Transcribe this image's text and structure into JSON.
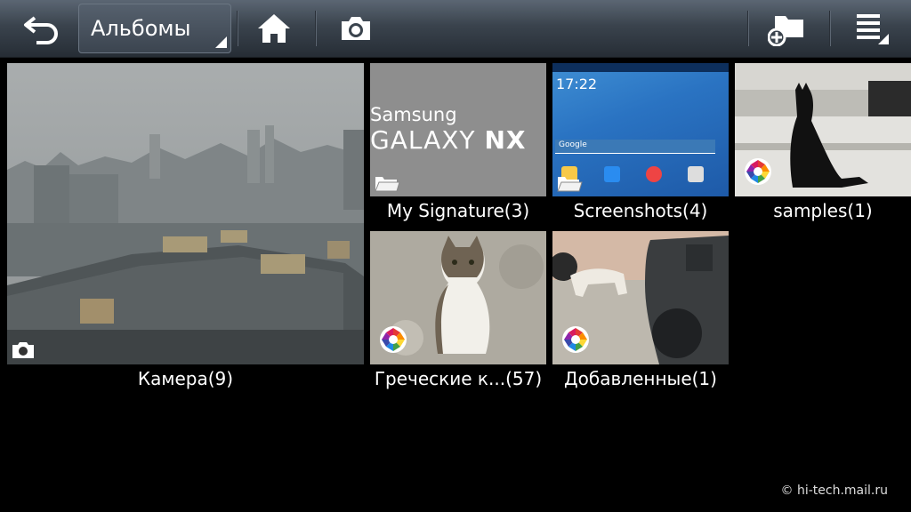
{
  "action_bar": {
    "album_selector_label": "Альбомы",
    "icons": [
      "back-icon",
      "home-icon",
      "camera-icon",
      "new-album-icon",
      "menu-icon"
    ]
  },
  "albums": [
    {
      "label": "Камера(9)",
      "badge": "camera-icon"
    },
    {
      "label": "My Signature(3)",
      "badge": "folder-icon",
      "thumb_text_1": "Samsung",
      "thumb_text_2": "GALAXY",
      "thumb_text_3": "NX"
    },
    {
      "label": "Screenshots(4)",
      "badge": "folder-icon",
      "clock": "17:22",
      "search_hint": "Google"
    },
    {
      "label": "samples(1)",
      "badge": "picasa-icon"
    },
    {
      "label": "Греческие к...(57)",
      "badge": "picasa-icon"
    },
    {
      "label": "Добавленные(1)",
      "badge": "picasa-icon"
    }
  ],
  "watermark": "© hi-tech.mail.ru",
  "colors": {
    "bar_top": "#5b6673",
    "bar_bottom": "#262d35",
    "background": "#000000"
  }
}
